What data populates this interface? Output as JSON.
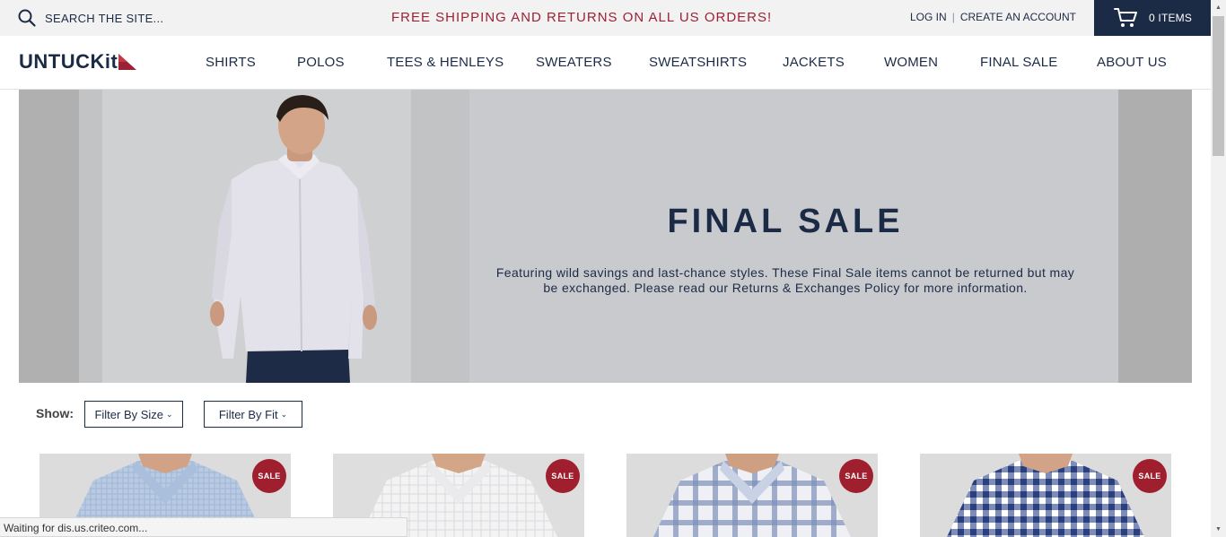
{
  "header": {
    "search_placeholder": "SEARCH THE SITE...",
    "promo": "FREE SHIPPING AND RETURNS ON ALL US ORDERS!",
    "login": "LOG IN",
    "separator": "|",
    "create_account": "CREATE AN ACCOUNT",
    "cart_label": "0 ITEMS"
  },
  "logo": {
    "text": "UNTUCKit"
  },
  "nav": {
    "items": [
      "SHIRTS",
      "POLOS",
      "TEES & HENLEYS",
      "SWEATERS",
      "SWEATSHIRTS",
      "JACKETS",
      "WOMEN",
      "FINAL SALE",
      "ABOUT US"
    ]
  },
  "hero": {
    "title": "FINAL SALE",
    "description": "Featuring wild savings and last-chance styles. These Final Sale items cannot be returned but may be exchanged. Please read our Returns & Exchanges Policy for more information."
  },
  "filters": {
    "show_label": "Show:",
    "size_label": "Filter By Size",
    "fit_label": "Filter By Fit"
  },
  "products": [
    {
      "badge": "SALE",
      "pattern": "light-blue-check"
    },
    {
      "badge": "SALE",
      "pattern": "white-grid"
    },
    {
      "badge": "SALE",
      "pattern": "blue-plaid"
    },
    {
      "badge": "SALE",
      "pattern": "navy-gingham"
    }
  ],
  "status_bar": {
    "text": "Waiting for dis.us.criteo.com..."
  },
  "colors": {
    "navy": "#1c2b45",
    "accent_red": "#9b2234",
    "sale_red": "#a01f2e"
  },
  "icons": [
    "search-icon",
    "cart-icon",
    "logo-flag-icon",
    "chevron-down-icon"
  ]
}
